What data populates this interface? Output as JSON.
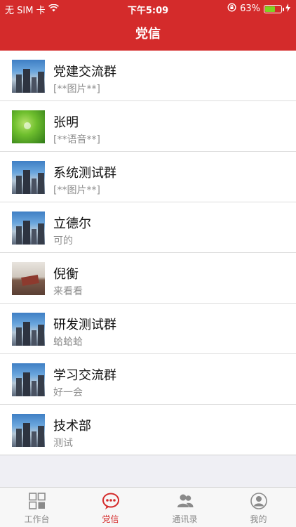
{
  "status_bar": {
    "carrier": "无 SIM 卡",
    "time": "下午5:09",
    "battery_percent": "63%",
    "battery_level": 0.63,
    "icons": [
      "wifi-icon",
      "orientation-lock-icon",
      "battery-icon",
      "charging-bolt-icon"
    ]
  },
  "header": {
    "title": "党信"
  },
  "conversations": [
    {
      "name": "党建交流群",
      "last_message": "[**图片**]",
      "avatar": "city"
    },
    {
      "name": "张明",
      "last_message": "[**语音**]",
      "avatar": "leaf"
    },
    {
      "name": "系统测试群",
      "last_message": "[**图片**]",
      "avatar": "city"
    },
    {
      "name": "立德尔",
      "last_message": "可的",
      "avatar": "city"
    },
    {
      "name": "倪衡",
      "last_message": "来看看",
      "avatar": "room"
    },
    {
      "name": "研发测试群",
      "last_message": "蛤蛤蛤",
      "avatar": "city"
    },
    {
      "name": "学习交流群",
      "last_message": "好一会",
      "avatar": "city"
    },
    {
      "name": "技术部",
      "last_message": "测试",
      "avatar": "city"
    }
  ],
  "tabbar": {
    "tabs": [
      {
        "label": "工作台",
        "icon": "grid-icon",
        "active": false
      },
      {
        "label": "党信",
        "icon": "chat-bubble-icon",
        "active": true
      },
      {
        "label": "通讯录",
        "icon": "contacts-icon",
        "active": false
      },
      {
        "label": "我的",
        "icon": "profile-icon",
        "active": false
      }
    ]
  },
  "colors": {
    "header_bg": "#d42b2b",
    "active_tab": "#d42b2b",
    "inactive_tab": "#8a8a8a",
    "battery_fill": "#7ed321"
  }
}
